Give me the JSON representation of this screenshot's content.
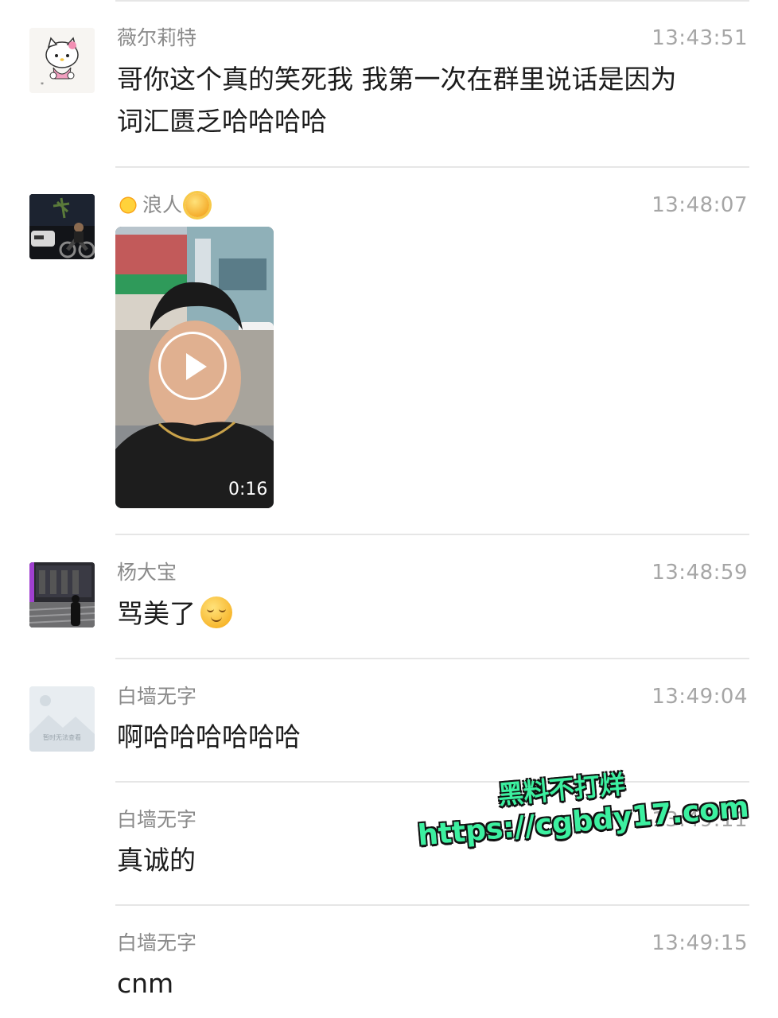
{
  "messages": [
    {
      "sender": "薇尔莉特",
      "time": "13:43:51",
      "text_line1": "哥你这个真的笑死我 我第一次在群里说话是因为",
      "text_line2": "词汇匮乏哈哈哈哈"
    },
    {
      "sender": "浪人",
      "time": "13:48:07",
      "video_duration": "0:16"
    },
    {
      "sender": "杨大宝",
      "time": "13:48:59",
      "text": "骂美了",
      "emoji": "relieved-face-emoji"
    },
    {
      "sender": "白墙无字",
      "time": "13:49:04",
      "text": "啊哈哈哈哈哈哈",
      "avatar_placeholder": "暂时无法查看"
    },
    {
      "sender": "白墙无字",
      "time": "13:49:11",
      "text": "真诚的"
    },
    {
      "sender": "白墙无字",
      "time": "13:49:15",
      "text": "cnm"
    }
  ],
  "watermark": {
    "line1": "黑料不打烊",
    "line2": "https://cgbdy17.com"
  },
  "colors": {
    "background": "#ffffff",
    "name_text": "#8a8a8a",
    "time_text": "#a6a6a6",
    "message_text": "#1c1c1c",
    "divider": "#e6e6e6",
    "watermark": "#3cf0a0"
  }
}
